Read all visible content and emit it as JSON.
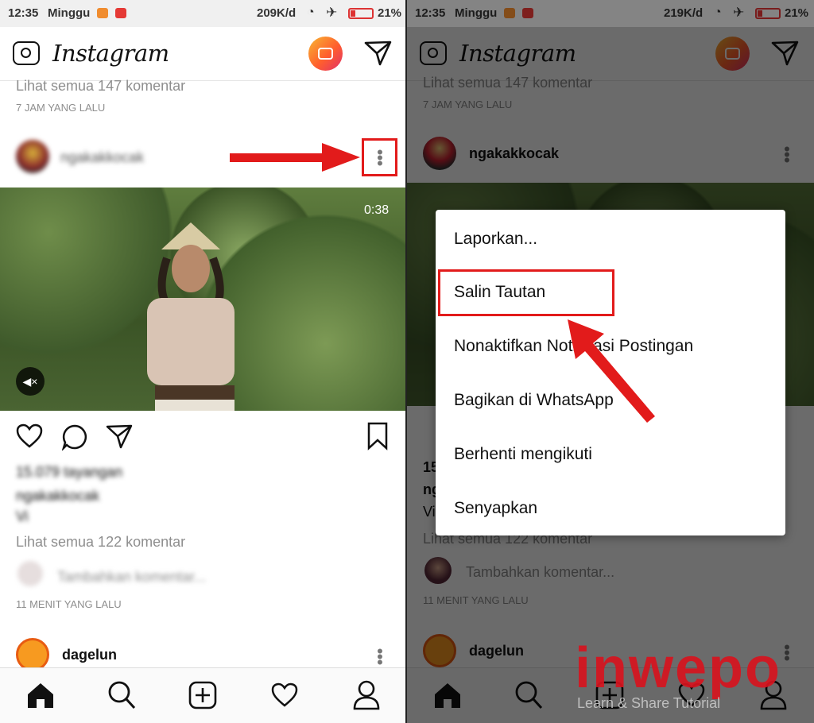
{
  "status_left": {
    "time": "12:35",
    "day": "Minggu",
    "speed": "209K/d",
    "battery": "21%"
  },
  "status_right": {
    "time": "12:35",
    "day": "Minggu",
    "speed": "219K/d",
    "battery": "21%"
  },
  "app": {
    "logo": "Instagram"
  },
  "feed": {
    "prev_comments": "Lihat semua 147 komentar",
    "prev_time": "7 JAM YANG LALU",
    "username": "ngakakkocak",
    "duration": "0:38",
    "views": "15.079 tayangan",
    "caption": "ngakakkocak",
    "caption_tag": "Vi",
    "comments": "Lihat semua 122 komentar",
    "add_comment": "Tambahkan komentar...",
    "time": "11 MENIT YANG LALU",
    "next_username": "dagelun"
  },
  "menu": {
    "items": [
      "Laporkan...",
      "Salin Tautan",
      "Nonaktifkan Notifikasi Postingan",
      "Bagikan di WhatsApp",
      "Berhenti mengikuti",
      "Senyapkan"
    ]
  },
  "watermark": {
    "brand": "inwepo",
    "tagline": "Learn & Share Tutorial"
  },
  "icons": {
    "home": "home-icon",
    "search": "search-icon",
    "add": "add-post-icon",
    "activity": "heart-icon",
    "profile": "profile-icon"
  },
  "colors": {
    "highlight": "#e21b1b",
    "accent_igtv": "#ff5f2d"
  }
}
